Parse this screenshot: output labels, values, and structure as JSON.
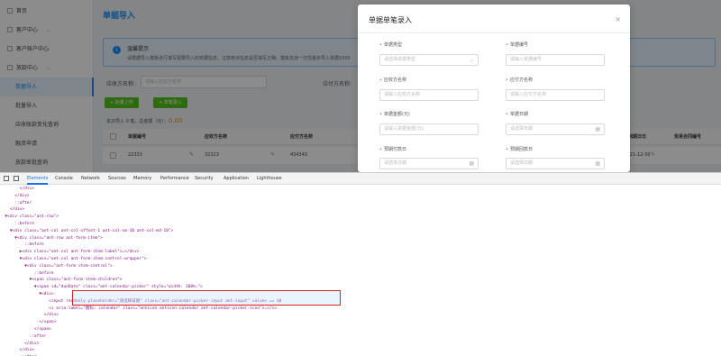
{
  "sidebar": {
    "items": [
      {
        "label": "首页",
        "chev": ""
      },
      {
        "label": "客户中心",
        "chev": "⌄"
      },
      {
        "label": "客户账户中心",
        "chev": "⌄"
      },
      {
        "label": "放款中心",
        "chev": "⌄"
      }
    ],
    "subitems": [
      "单据导入",
      "批量导入",
      "应收账款变化查询",
      "融资申请",
      "放款审批查询"
    ]
  },
  "main": {
    "title": "单据导入",
    "alert_title": "温馨提示",
    "alert_desc": "请根据导入模板进行填写需要导入的单据信息，注意核对信息是否填写正确，模板支持一次性最多导入单据1000",
    "filter_label1": "应收方名称:",
    "filter_placeholder1": "请输入应收方名称",
    "filter_label2": "应付方名称:",
    "btn_batch": "+ 批量上传",
    "btn_single": "+ 单笔录入",
    "summary_prefix": "本次导入 ",
    "summary_count": "0",
    "summary_mid": " 笔，总金额（元）：",
    "summary_amount": "0.00",
    "columns": [
      "单据编号",
      "应收方名称",
      "应付方名称",
      "到期日日",
      "贸易合同编号"
    ],
    "row": {
      "no": "22333",
      "receivable": "32323",
      "payable": "434343",
      "due": "-21-12-30"
    }
  },
  "modal": {
    "title": "单据单笔录入",
    "close": "×",
    "fields": [
      {
        "label": "单据类型",
        "placeholder": "请选择单据类型",
        "suffix": "⌄"
      },
      {
        "label": "单据编号",
        "placeholder": "请输入单据编号",
        "suffix": ""
      },
      {
        "label": "应收方名称",
        "placeholder": "请输入应收方名称",
        "suffix": ""
      },
      {
        "label": "应付方名称",
        "placeholder": "请输入应付方名称",
        "suffix": ""
      },
      {
        "label": "单据金额(元)",
        "placeholder": "请输入单据金额(元)",
        "suffix": ""
      },
      {
        "label": "单据日期",
        "placeholder": "请选择日期",
        "suffix": "▦"
      },
      {
        "label": "预期付款日",
        "placeholder": "请选择日期",
        "suffix": "▦"
      },
      {
        "label": "预期回款日",
        "placeholder": "请选择日期",
        "suffix": "▦"
      }
    ]
  },
  "devtools": {
    "tabs": [
      "Elements",
      "Console",
      "Network",
      "Sources",
      "Memory",
      "Performance",
      "Security",
      "Application",
      "Lighthouse"
    ],
    "lines": [
      "        </div>",
      "      </div>",
      "      ::after",
      "    </div>",
      "  ▼<div class=\"ant-row\">",
      "      ::before",
      "    ▼<div class=\"ant-col ant-col-offset-1 ant-col-sm-10 ant-col-md-10\">",
      "      ▼<div class=\"ant-row ant-form-item\">",
      "          ::before",
      "        ▶<div class=\"ant-col ant-form-item-label\">…</div>",
      "        ▼<div class=\"ant-col ant-form-item-control-wrapper\">",
      "          ▼<div class=\"ant-form-item-control\">",
      "              ::before",
      "            ▼<span class=\"ant-form-item-children\">",
      "              ▼<span id=\"dueDate\" class=\"ant-calendar-picker\" style=\"width: 100%;\">",
      "                ▼<div>",
      "                    <input readonly placeholder=\"请选择日期\" class=\"ant-calendar-picker-input ant-input\" value> == $0",
      "                    <i aria-label=\"图标: calendar\" class=\"anticon anticon-calendar ant-calendar-picker-icon\">…</i>",
      "                  </div>",
      "                </span>",
      "              </span>",
      "            ::after",
      "          </div>",
      "        </div>",
      "        ::after",
      "      </div>"
    ]
  }
}
